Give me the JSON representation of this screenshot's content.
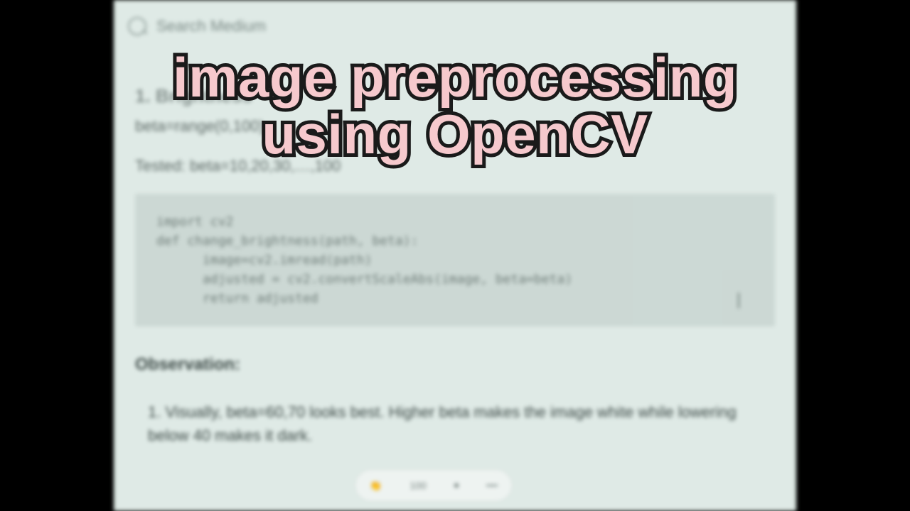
{
  "overlay": {
    "line1": "image preprocessing",
    "line2": "using OpenCV"
  },
  "search": {
    "placeholder": "Search Medium"
  },
  "article": {
    "section_heading": "1. Brightness",
    "param_line": "beta=range(0,100)",
    "tested_line": "Tested: beta=10,20,30,…,100",
    "code": "import cv2\ndef change_brightness(path, beta):\n      image=cv2.imread(path)\n      adjusted = cv2.convertScaleAbs(image, beta=beta)\n      return adjusted",
    "observation_heading": "Observation:",
    "observation_item": "1. Visually, beta=60,70 looks best. Higher beta makes the image white while lowering below 40 makes it dark."
  },
  "pill": {
    "label": "100"
  }
}
